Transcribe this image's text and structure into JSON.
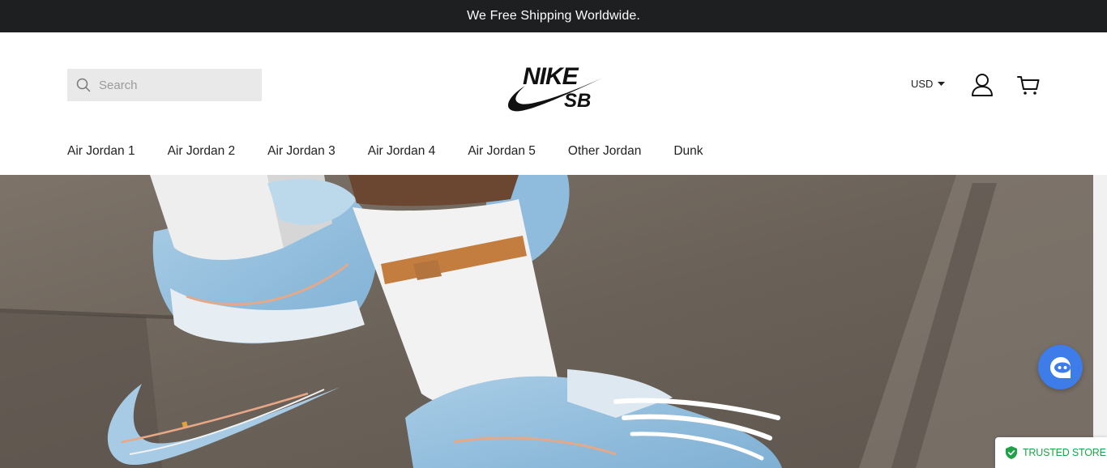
{
  "announcement": {
    "text": "We Free Shipping Worldwide."
  },
  "header": {
    "search": {
      "placeholder": "Search"
    },
    "logo": {
      "brand": "NIKE",
      "sub": "SB"
    },
    "currency": {
      "label": "USD"
    },
    "icons": [
      "search-icon",
      "user-icon",
      "cart-icon",
      "chevron-down-icon"
    ]
  },
  "nav": {
    "items": [
      {
        "label": "Air Jordan 1"
      },
      {
        "label": "Air Jordan 2"
      },
      {
        "label": "Air Jordan 3"
      },
      {
        "label": "Air Jordan 4"
      },
      {
        "label": "Air Jordan 5"
      },
      {
        "label": "Other Jordan"
      },
      {
        "label": "Dunk"
      }
    ]
  },
  "badge": {
    "label": "TRUSTED STORE"
  },
  "colors": {
    "announce_bg": "#1e1f21",
    "chat_button": "#3d7ce9",
    "trusted_green": "#1fa247"
  }
}
